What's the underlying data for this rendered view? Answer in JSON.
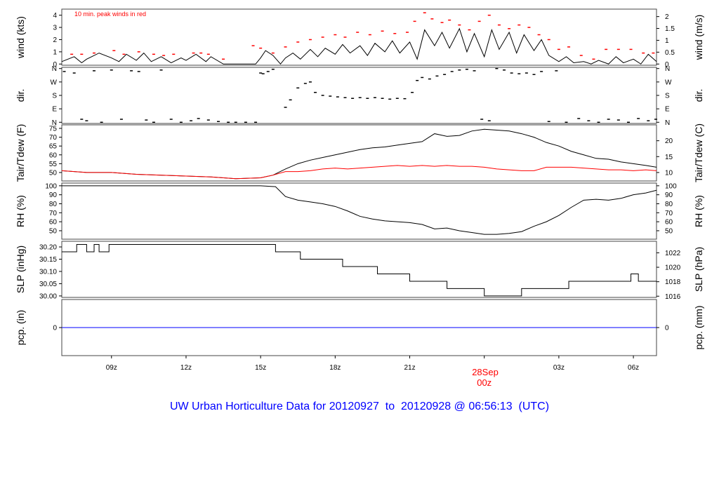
{
  "chart_data": {
    "type": "line",
    "title": "UW Urban Horticulture Data for 20120927  to  20120928 @ 06:56:13  (UTC)",
    "x_range_hours": [
      7.0,
      30.93
    ],
    "x_ticks": [
      {
        "h": 9,
        "label": "09z"
      },
      {
        "h": 12,
        "label": "12z"
      },
      {
        "h": 15,
        "label": "15z"
      },
      {
        "h": 18,
        "label": "18z"
      },
      {
        "h": 21,
        "label": "21z"
      },
      {
        "h": 24,
        "label": "00z",
        "highlight": true
      },
      {
        "h": 27,
        "label": "03z"
      },
      {
        "h": 30,
        "label": "06z"
      }
    ],
    "date_label": "28Sep",
    "colors": {
      "title": "#0000ff",
      "peak": "#ff0000",
      "dew": "#ff0000",
      "date": "#ff0000",
      "pcp": "#0000ff",
      "line": "#000000"
    },
    "panels": [
      {
        "id": "wind",
        "ylabel": "wind (kts)",
        "ylabel_right": "wind (m/s)",
        "annotation": "10 min. peak winds in red",
        "ylim": [
          -0.1,
          4.5
        ],
        "ticks": [
          0,
          1,
          2,
          3,
          4
        ],
        "tick_labels": [
          "0",
          "1",
          "2",
          "3",
          "4"
        ],
        "rticks_vals": [
          0,
          0.972,
          1.944,
          2.916,
          3.888
        ],
        "rtick_labels": [
          "0",
          "0.5",
          "1",
          "1.5",
          "2"
        ],
        "series": [
          {
            "name": "wind speed",
            "color": "#000000",
            "x": [
              7,
              7.5,
              7.8,
              8,
              8.5,
              9,
              9.3,
              9.6,
              10,
              10.3,
              10.6,
              11,
              11.4,
              11.8,
              12,
              12.4,
              12.8,
              13,
              13.5,
              14,
              14.5,
              14.8,
              15,
              15.2,
              15.5,
              15.8,
              16,
              16.3,
              16.6,
              17,
              17.3,
              17.6,
              18,
              18.3,
              18.6,
              19,
              19.3,
              19.6,
              20,
              20.3,
              20.6,
              21,
              21.3,
              21.6,
              22,
              22.3,
              22.6,
              23,
              23.3,
              23.6,
              24,
              24.3,
              24.6,
              25,
              25.3,
              25.6,
              26,
              26.3,
              26.6,
              27,
              27.3,
              27.6,
              28,
              28.3,
              28.6,
              29,
              29.3,
              29.6,
              30,
              30.3,
              30.6,
              30.93
            ],
            "y": [
              0.2,
              0.6,
              0.1,
              0.4,
              0.9,
              0.5,
              0.2,
              0.8,
              0.3,
              0.9,
              0.2,
              0.6,
              0.1,
              0.5,
              0.3,
              0.8,
              0.2,
              0.6,
              0,
              0,
              0,
              0,
              0.5,
              1.1,
              0.7,
              0,
              0.5,
              0.9,
              0.4,
              1.2,
              0.6,
              1.3,
              0.8,
              1.6,
              0.9,
              1.5,
              0.7,
              1.7,
              1.0,
              1.9,
              0.9,
              1.8,
              0.4,
              2.8,
              1.5,
              2.6,
              1.3,
              2.9,
              1.0,
              2.5,
              0.6,
              2.8,
              1.2,
              2.6,
              0.9,
              2.4,
              1.1,
              2.0,
              0.7,
              0.2,
              0.6,
              0.1,
              0.2,
              0,
              0.3,
              0,
              0.6,
              0.1,
              0.4,
              0,
              0.8,
              0.2,
              0.6
            ]
          },
          {
            "name": "10 min peak",
            "color": "#ff0000",
            "style": "dash",
            "x": [
              7.4,
              7.8,
              8.3,
              9.1,
              9.5,
              10.1,
              10.7,
              11.1,
              11.5,
              12.3,
              12.6,
              12.9,
              13.5,
              14.7,
              15.0,
              15.5,
              16.0,
              16.5,
              17.0,
              17.5,
              18.0,
              18.4,
              18.9,
              19.4,
              19.9,
              20.4,
              20.9,
              21.2,
              21.6,
              21.9,
              22.3,
              22.6,
              23.0,
              23.4,
              23.8,
              24.2,
              24.6,
              25.0,
              25.4,
              25.8,
              26.2,
              26.6,
              27.0,
              27.4,
              27.9,
              28.4,
              28.9,
              29.4,
              29.9,
              30.4,
              30.8
            ],
            "y": [
              0.8,
              0.8,
              0.9,
              1.1,
              0.8,
              1.0,
              0.8,
              0.7,
              0.8,
              0.9,
              0.9,
              0.8,
              0.4,
              1.5,
              1.3,
              0.9,
              1.4,
              1.8,
              2.0,
              2.2,
              2.4,
              2.2,
              2.6,
              2.4,
              2.7,
              2.5,
              2.6,
              3.5,
              4.2,
              3.7,
              3.4,
              3.6,
              3.2,
              2.8,
              3.5,
              4.0,
              3.2,
              2.9,
              3.2,
              3.0,
              2.4,
              2.0,
              1.2,
              1.4,
              0.7,
              0.4,
              1.2,
              1.2,
              1.2,
              0.9,
              0.9
            ]
          }
        ]
      },
      {
        "id": "dir",
        "ylabel": "dir.",
        "ylabel_right": "dir.",
        "ylim": [
          -8,
          368
        ],
        "ticks": [
          0,
          90,
          180,
          270,
          360
        ],
        "tick_labels": [
          "N",
          "E",
          "S",
          "W",
          "N"
        ],
        "rticks_vals": [
          0,
          90,
          180,
          270,
          360
        ],
        "rtick_labels": [
          "N",
          "E",
          "S",
          "W",
          "N"
        ],
        "series": [
          {
            "name": "wind direction",
            "color": "#000000",
            "style": "points",
            "x": [
              7.1,
              7.5,
              7.8,
              8.0,
              8.3,
              8.6,
              9.0,
              9.4,
              9.8,
              10.1,
              10.4,
              10.7,
              11.0,
              11.4,
              11.8,
              12.2,
              12.5,
              12.9,
              13.3,
              13.7,
              14.0,
              14.4,
              14.8,
              15.0,
              15.1,
              15.3,
              15.5,
              16.0,
              16.2,
              16.5,
              16.8,
              17.0,
              17.2,
              17.5,
              17.8,
              18.1,
              18.4,
              18.7,
              19.0,
              19.3,
              19.6,
              19.9,
              20.2,
              20.5,
              20.8,
              21.1,
              21.3,
              21.5,
              21.8,
              22.1,
              22.4,
              22.7,
              23.0,
              23.3,
              23.6,
              23.9,
              24.2,
              24.5,
              24.8,
              25.1,
              25.4,
              25.7,
              26.0,
              26.3,
              26.6,
              26.9,
              27.3,
              27.8,
              28.2,
              28.6,
              29.0,
              29.4,
              29.8,
              30.2,
              30.6,
              30.9
            ],
            "y": [
              340,
              330,
              20,
              10,
              345,
              0,
              350,
              20,
              345,
              340,
              15,
              0,
              350,
              20,
              0,
              10,
              25,
              15,
              5,
              0,
              0,
              0,
              0,
              330,
              325,
              340,
              355,
              100,
              150,
              230,
              260,
              270,
              200,
              180,
              175,
              170,
              165,
              160,
              165,
              160,
              165,
              160,
              155,
              160,
              158,
              200,
              280,
              300,
              290,
              310,
              320,
              340,
              350,
              355,
              345,
              20,
              10,
              360,
              350,
              330,
              325,
              330,
              320,
              340,
              5,
              345,
              0,
              25,
              10,
              0,
              20,
              15,
              0,
              25,
              10,
              20
            ]
          }
        ]
      },
      {
        "id": "temp",
        "ylabel": "Tair/Tdew (F)",
        "ylabel_right": "Tair/Tdew (C)",
        "ylim": [
          45.2,
          77
        ],
        "ticks": [
          50,
          55,
          60,
          65,
          70,
          75
        ],
        "tick_labels": [
          "50",
          "55",
          "60",
          "65",
          "70",
          "75"
        ],
        "rticks_vals": [
          50,
          59,
          68
        ],
        "rtick_labels": [
          "10",
          "15",
          "20"
        ],
        "series": [
          {
            "name": "Tair",
            "color": "#000000",
            "x": [
              7,
              8,
              9,
              10,
              11,
              12,
              13,
              14,
              15,
              15.5,
              16,
              16.5,
              17,
              17.5,
              18,
              18.5,
              19,
              19.5,
              20,
              20.5,
              21,
              21.5,
              22,
              22.5,
              23,
              23.5,
              24,
              24.5,
              25,
              25.5,
              26,
              26.5,
              27,
              27.5,
              28,
              28.5,
              29,
              29.5,
              30,
              30.5,
              30.93
            ],
            "y": [
              51,
              50,
              50,
              49,
              48.5,
              48,
              47.5,
              46.5,
              47,
              48.5,
              52,
              55,
              57,
              58.5,
              60,
              61.5,
              63,
              64,
              64.5,
              65.5,
              66.5,
              67.5,
              72,
              70.5,
              71,
              73.5,
              74.5,
              74,
              73.5,
              72,
              70,
              67,
              65,
              62,
              60,
              58,
              57.5,
              56,
              55,
              54,
              53
            ]
          },
          {
            "name": "Tdew",
            "color": "#ff0000",
            "x": [
              7,
              8,
              9,
              10,
              11,
              12,
              13,
              14,
              15,
              15.5,
              16,
              16.5,
              17,
              17.5,
              18,
              18.5,
              19,
              19.5,
              20,
              20.5,
              21,
              21.5,
              22,
              22.5,
              23,
              23.5,
              24,
              24.5,
              25,
              25.5,
              26,
              26.5,
              27,
              27.5,
              28,
              28.5,
              29,
              29.5,
              30,
              30.5,
              30.93
            ],
            "y": [
              51,
              50,
              50,
              49,
              48.5,
              48,
              47.5,
              46.5,
              47,
              48.5,
              50.5,
              50.5,
              51,
              52,
              52.5,
              52,
              52.5,
              53,
              53.5,
              54,
              53.5,
              54,
              53.5,
              54,
              53.5,
              53.5,
              53,
              52,
              51.5,
              51,
              51,
              53,
              53,
              53,
              52.5,
              52,
              51.5,
              51.5,
              51,
              51.5,
              51
            ]
          }
        ]
      },
      {
        "id": "rh",
        "ylabel": "RH (%)",
        "ylabel_right": "RH (%)",
        "ylim": [
          40.6,
          103
        ],
        "ticks": [
          50,
          60,
          70,
          80,
          90,
          100
        ],
        "tick_labels": [
          "50",
          "60",
          "70",
          "80",
          "90",
          "100"
        ],
        "rticks_vals": [
          50,
          60,
          70,
          80,
          90,
          100
        ],
        "rtick_labels": [
          "50",
          "60",
          "70",
          "80",
          "90",
          "100"
        ],
        "series": [
          {
            "name": "RH",
            "color": "#000000",
            "x": [
              7,
              8,
              9,
              10,
              11,
              12,
              13,
              14,
              15,
              15.6,
              16,
              16.5,
              17,
              17.5,
              18,
              18.5,
              19,
              19.5,
              20,
              20.5,
              21,
              21.5,
              22,
              22.5,
              23,
              23.5,
              24,
              24.5,
              25,
              25.5,
              26,
              26.5,
              27,
              27.5,
              28,
              28.5,
              29,
              29.5,
              30,
              30.5,
              30.93
            ],
            "y": [
              100,
              100,
              100,
              100,
              100,
              100,
              100,
              100,
              100,
              99,
              88,
              84,
              82,
              80,
              77,
              72,
              66,
              63,
              61,
              60,
              59,
              57,
              52,
              53,
              50,
              48,
              46,
              46,
              47,
              49,
              55,
              60,
              67,
              76,
              84,
              85,
              84,
              86,
              90,
              92,
              95
            ]
          }
        ]
      },
      {
        "id": "slp",
        "ylabel": "SLP (inHg)",
        "ylabel_right": "SLP (hPa)",
        "ylim": [
          29.994,
          30.223
        ],
        "ticks": [
          30.0,
          30.05,
          30.1,
          30.15,
          30.2
        ],
        "tick_labels": [
          "30.00",
          "30.05",
          "30.10",
          "30.15",
          "30.20"
        ],
        "rticks_vals": [
          29.999,
          30.058,
          30.117,
          30.176
        ],
        "rtick_labels": [
          "1016",
          "1018",
          "1020",
          "1022"
        ],
        "series": [
          {
            "name": "SLP",
            "color": "#000000",
            "style": "step",
            "x": [
              7,
              7.6,
              8.0,
              8.3,
              8.5,
              8.9,
              15.6,
              16.6,
              18.3,
              19.7,
              21.0,
              22.5,
              24.0,
              25.5,
              27.4,
              29.9,
              30.1,
              30.2,
              30.93
            ],
            "y": [
              30.18,
              30.21,
              30.18,
              30.21,
              30.18,
              30.21,
              30.18,
              30.15,
              30.12,
              30.09,
              30.06,
              30.03,
              30.0,
              30.03,
              30.06,
              30.09,
              30.09,
              30.06,
              30.06
            ]
          }
        ]
      },
      {
        "id": "pcp",
        "ylabel": "pcp. (in)",
        "ylabel_right": "pcp. (mm)",
        "ylim": [
          -1,
          1
        ],
        "ticks": [
          0
        ],
        "tick_labels": [
          "0"
        ],
        "rticks_vals": [
          0
        ],
        "rtick_labels": [
          "0"
        ],
        "series": [
          {
            "name": "precipitation",
            "color": "#0000ff",
            "x": [
              7,
              30.93
            ],
            "y": [
              0,
              0
            ]
          }
        ]
      }
    ]
  }
}
